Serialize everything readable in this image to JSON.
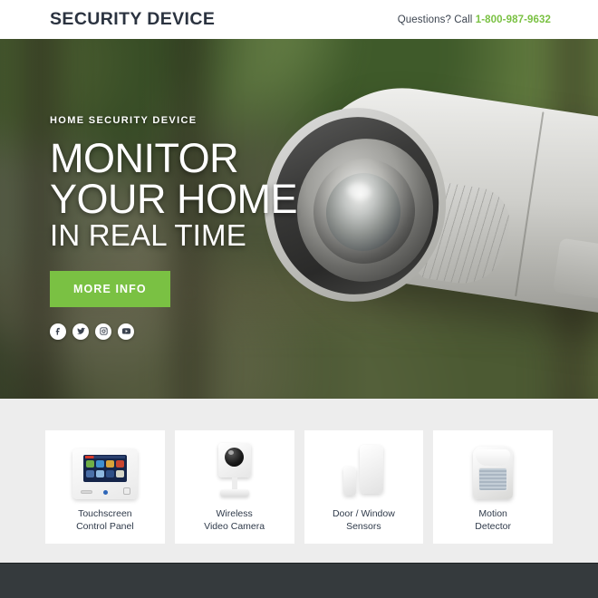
{
  "header": {
    "logo": "SECURITY DEVICE",
    "contact_prefix": "Questions? Call ",
    "phone": "1-800-987-9632",
    "phone_color": "#7ac143",
    "logo_color": "#2b3340"
  },
  "hero": {
    "eyebrow": "HOME SECURITY DEVICE",
    "headline_line1": "MONITOR",
    "headline_line2": "YOUR HOME",
    "headline_line3": "IN REAL TIME",
    "cta_label": "MORE INFO",
    "cta_color": "#7ac143",
    "background_subject": "outdoor bullet cctv camera on blurred green foliage",
    "socials": [
      {
        "name": "facebook",
        "icon": "facebook-icon"
      },
      {
        "name": "twitter",
        "icon": "twitter-icon"
      },
      {
        "name": "instagram",
        "icon": "instagram-icon"
      },
      {
        "name": "youtube",
        "icon": "youtube-icon"
      }
    ]
  },
  "products": {
    "background_color": "#ededed",
    "cards": [
      {
        "label_line1": "Touchscreen",
        "label_line2": "Control Panel",
        "image": "touchscreen-control-panel-image"
      },
      {
        "label_line1": "Wireless",
        "label_line2": "Video Camera",
        "image": "wireless-video-camera-image"
      },
      {
        "label_line1": "Door / Window",
        "label_line2": "Sensors",
        "image": "door-window-sensors-image"
      },
      {
        "label_line1": "Motion",
        "label_line2": "Detector",
        "image": "motion-detector-image"
      }
    ]
  },
  "footer": {
    "background_color": "#353a3d"
  }
}
